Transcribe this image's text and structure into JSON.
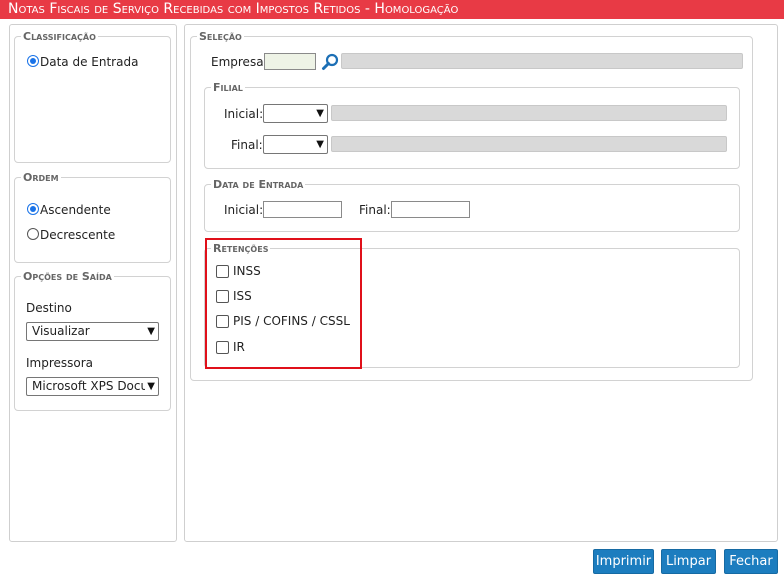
{
  "title": "Notas Fiscais de Serviço Recebidas com Impostos Retidos  - Homologação",
  "classificacao": {
    "legend": "Classificação",
    "options": [
      {
        "label": "Data de Entrada",
        "selected": true
      }
    ]
  },
  "ordem": {
    "legend": "Ordem",
    "options": [
      {
        "label": "Ascendente",
        "selected": true
      },
      {
        "label": "Decrescente",
        "selected": false
      }
    ]
  },
  "opcoes_saida": {
    "legend": "Opções de Saída",
    "destino_label": "Destino",
    "destino_value": "Visualizar",
    "impressora_label": "Impressora",
    "impressora_value": "Microsoft XPS Docur"
  },
  "selecao": {
    "legend": "Seleção",
    "empresa_label": "Empresa:",
    "empresa_value": "",
    "filial": {
      "legend": "Filial",
      "inicial_label": "Inicial:",
      "inicial_value": "",
      "final_label": "Final:",
      "final_value": ""
    },
    "data_entrada": {
      "legend": "Data de Entrada",
      "inicial_label": "Inicial:",
      "inicial_value": "",
      "final_label": "Final:",
      "final_value": ""
    },
    "retencoes": {
      "legend": "Retenções",
      "items": [
        {
          "label": "INSS",
          "checked": false
        },
        {
          "label": "ISS",
          "checked": false
        },
        {
          "label": "PIS / COFINS / CSSL",
          "checked": false
        },
        {
          "label": "IR",
          "checked": false
        }
      ]
    }
  },
  "buttons": {
    "imprimir": "Imprimir",
    "limpar": "Limpar",
    "fechar": "Fechar"
  },
  "colors": {
    "titlebar": "#e83a45",
    "button": "#1c7dbf",
    "highlight": "#e0101a",
    "radio_accent": "#1a73e8"
  },
  "icons": {
    "search": "search-icon",
    "dropdown": "chevron-down-icon"
  }
}
